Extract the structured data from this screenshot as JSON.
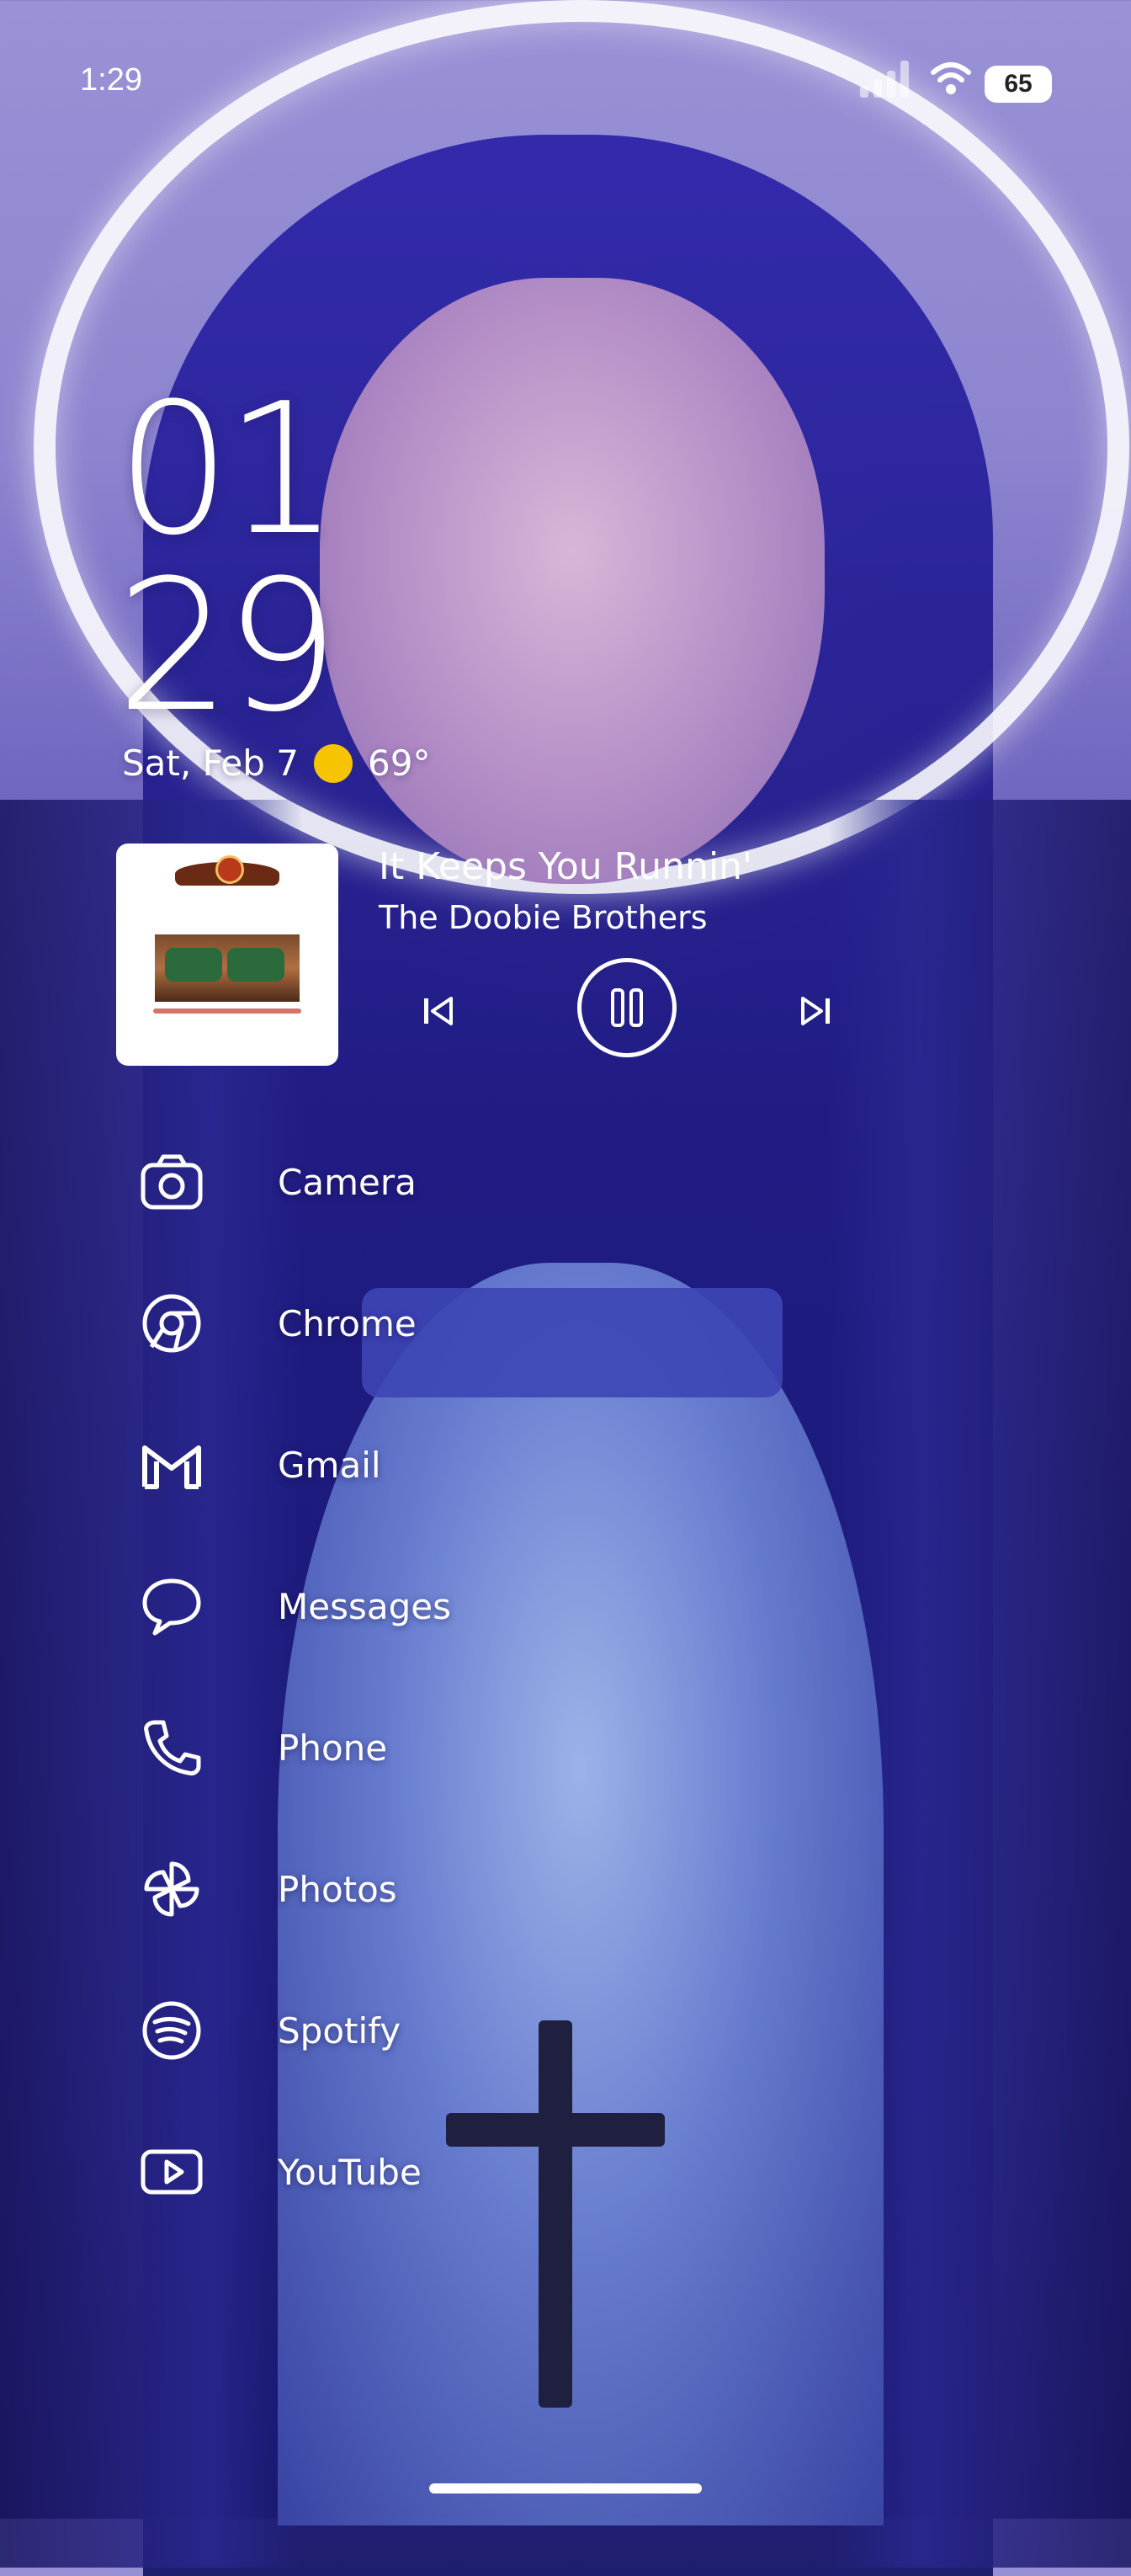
{
  "status_bar": {
    "time": "1:29",
    "battery": "65"
  },
  "clock": {
    "hours": "01",
    "minutes": "29"
  },
  "date": {
    "text": "Sat, Feb 7",
    "temperature": "69°",
    "weather_icon": "sun-icon"
  },
  "media": {
    "song": "It Keeps You Runnin'",
    "artist": "The Doobie Brothers",
    "state": "playing"
  },
  "apps": [
    {
      "label": "Camera",
      "icon": "camera-icon"
    },
    {
      "label": "Chrome",
      "icon": "chrome-icon"
    },
    {
      "label": "Gmail",
      "icon": "gmail-icon"
    },
    {
      "label": "Messages",
      "icon": "messages-icon"
    },
    {
      "label": "Phone",
      "icon": "phone-icon"
    },
    {
      "label": "Photos",
      "icon": "photos-icon"
    },
    {
      "label": "Spotify",
      "icon": "spotify-icon"
    },
    {
      "label": "YouTube",
      "icon": "youtube-icon"
    }
  ],
  "colors": {
    "accent_sun": "#f6c400",
    "text": "#ffffff"
  }
}
